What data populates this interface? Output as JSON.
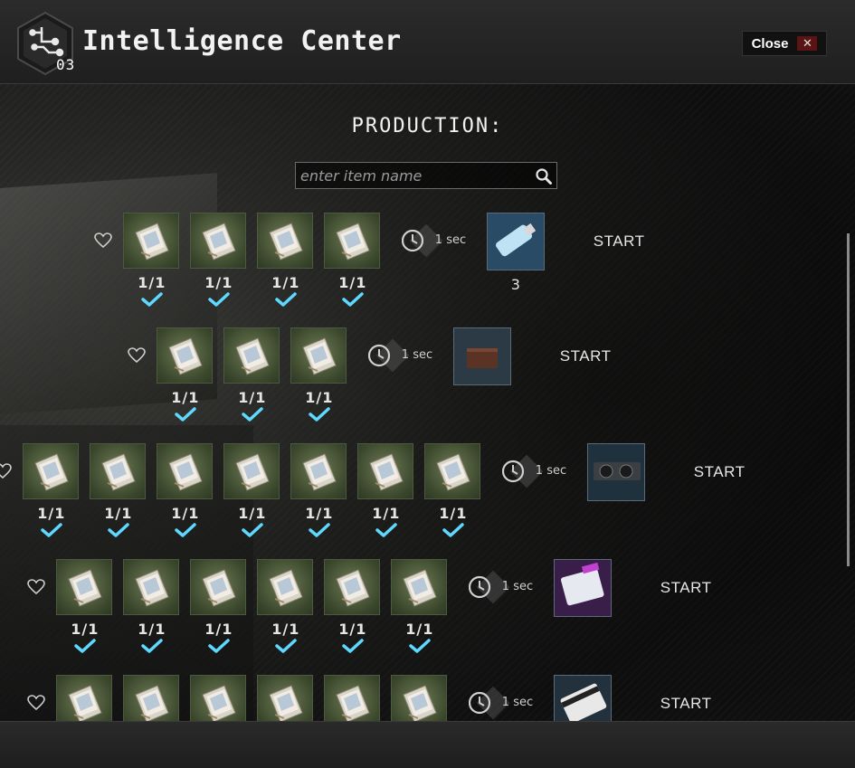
{
  "header": {
    "title": "Intelligence Center",
    "level": "03",
    "close_label": "Close",
    "close_symbol": "✕"
  },
  "section_title": "PRODUCTION:",
  "search": {
    "placeholder": "enter item name",
    "value": ""
  },
  "colors": {
    "check": "#5fd8ff",
    "slot_green": "#3d4a2e",
    "close_red": "#5a1414"
  },
  "recipes": [
    {
      "requirements": [
        {
          "item": "intelligence-folder-icon",
          "count": "1/1",
          "met": true
        },
        {
          "item": "intelligence-folder-icon",
          "count": "1/1",
          "met": true
        },
        {
          "item": "intelligence-folder-icon",
          "count": "1/1",
          "met": true
        },
        {
          "item": "intelligence-folder-icon",
          "count": "1/1",
          "met": true
        }
      ],
      "time": "1 sec",
      "output": {
        "item": "usb-flash-drive-icon",
        "count": "3"
      },
      "action": "START"
    },
    {
      "requirements": [
        {
          "item": "intelligence-folder-icon",
          "count": "1/1",
          "met": true
        },
        {
          "item": "intelligence-folder-icon",
          "count": "1/1",
          "met": true
        },
        {
          "item": "intelligence-folder-icon",
          "count": "1/1",
          "met": true
        }
      ],
      "time": "1 sec",
      "output": {
        "item": "leather-wallet-icon",
        "count": ""
      },
      "action": "START"
    },
    {
      "requirements": [
        {
          "item": "intelligence-folder-icon",
          "count": "1/1",
          "met": true
        },
        {
          "item": "intelligence-folder-icon",
          "count": "1/1",
          "met": true
        },
        {
          "item": "intelligence-folder-icon",
          "count": "1/1",
          "met": true
        },
        {
          "item": "intelligence-folder-icon",
          "count": "1/1",
          "met": true
        },
        {
          "item": "intelligence-folder-icon",
          "count": "1/1",
          "met": true
        },
        {
          "item": "intelligence-folder-icon",
          "count": "1/1",
          "met": true
        },
        {
          "item": "intelligence-folder-icon",
          "count": "1/1",
          "met": true
        }
      ],
      "time": "1 sec",
      "output": {
        "item": "graphics-card-icon",
        "count": ""
      },
      "action": "START"
    },
    {
      "requirements": [
        {
          "item": "intelligence-folder-icon",
          "count": "1/1",
          "met": true
        },
        {
          "item": "intelligence-folder-icon",
          "count": "1/1",
          "met": true
        },
        {
          "item": "intelligence-folder-icon",
          "count": "1/1",
          "met": true
        },
        {
          "item": "intelligence-folder-icon",
          "count": "1/1",
          "met": true
        },
        {
          "item": "intelligence-folder-icon",
          "count": "1/1",
          "met": true
        },
        {
          "item": "intelligence-folder-icon",
          "count": "1/1",
          "met": true
        }
      ],
      "time": "1 sec",
      "output": {
        "item": "labs-keycard-icon",
        "count": ""
      },
      "action": "START"
    },
    {
      "requirements": [
        {
          "item": "intelligence-folder-icon",
          "count": "",
          "met": true
        },
        {
          "item": "intelligence-folder-icon",
          "count": "",
          "met": true
        },
        {
          "item": "intelligence-folder-icon",
          "count": "",
          "met": true
        },
        {
          "item": "intelligence-folder-icon",
          "count": "",
          "met": true
        },
        {
          "item": "intelligence-folder-icon",
          "count": "",
          "met": true
        },
        {
          "item": "intelligence-folder-icon",
          "count": "",
          "met": true
        }
      ],
      "time": "1 sec",
      "output": {
        "item": "white-keycard-icon",
        "count": ""
      },
      "action": "START"
    }
  ]
}
